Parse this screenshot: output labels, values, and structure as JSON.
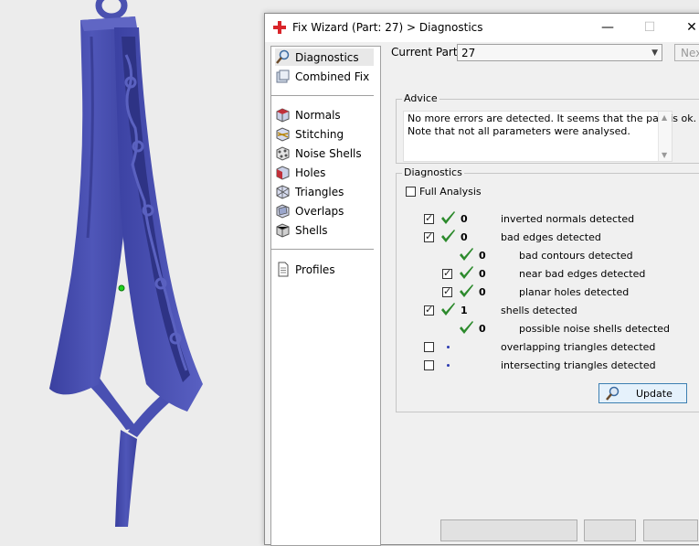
{
  "window": {
    "title": "Fix Wizard (Part: 27) > Diagnostics",
    "minimize_glyph": "—",
    "maximize_glyph": "☐",
    "close_glyph": "✕"
  },
  "sidebar": {
    "items": [
      {
        "label": "Diagnostics",
        "icon": "magnifier-icon"
      },
      {
        "label": "Combined Fix",
        "icon": "combined-fix-icon"
      },
      {
        "label": "Normals",
        "icon": "normals-cube-icon"
      },
      {
        "label": "Stitching",
        "icon": "stitching-cube-icon"
      },
      {
        "label": "Noise Shells",
        "icon": "noise-shells-icon"
      },
      {
        "label": "Holes",
        "icon": "holes-cube-icon"
      },
      {
        "label": "Triangles",
        "icon": "triangles-cube-icon"
      },
      {
        "label": "Overlaps",
        "icon": "overlaps-cube-icon"
      },
      {
        "label": "Shells",
        "icon": "shells-cube-icon"
      },
      {
        "label": "Profiles",
        "icon": "profiles-document-icon"
      }
    ]
  },
  "part": {
    "label": "Current Part:",
    "value": "27",
    "next_label": "Next"
  },
  "advice": {
    "group_label": "Advice",
    "line1": "No more errors are detected. It seems that the part is ok.",
    "line2": "Note that not all parameters were analysed."
  },
  "diagnostics": {
    "group_label": "Diagnostics",
    "full_analysis_label": "Full Analysis",
    "full_analysis_checked": false,
    "rows": [
      {
        "count": "0",
        "text": "inverted normals detected",
        "checkbox": true,
        "checked": true,
        "status": "ok",
        "indent": false
      },
      {
        "count": "0",
        "text": "bad edges detected",
        "checkbox": true,
        "checked": true,
        "status": "ok",
        "indent": false
      },
      {
        "count": "0",
        "text": "bad contours detected",
        "checkbox": false,
        "checked": false,
        "status": "ok",
        "indent": true
      },
      {
        "count": "0",
        "text": "near bad edges detected",
        "checkbox": true,
        "checked": true,
        "status": "ok",
        "indent": true
      },
      {
        "count": "0",
        "text": "planar holes detected",
        "checkbox": true,
        "checked": true,
        "status": "ok",
        "indent": true
      },
      {
        "count": "1",
        "text": "shells detected",
        "checkbox": true,
        "checked": true,
        "status": "ok",
        "indent": false
      },
      {
        "count": "0",
        "text": "possible noise shells detected",
        "checkbox": false,
        "checked": false,
        "status": "ok",
        "indent": true
      },
      {
        "count": "",
        "text": "overlapping triangles detected",
        "checkbox": true,
        "checked": false,
        "status": "pending",
        "indent": false
      },
      {
        "count": "",
        "text": "intersecting triangles detected",
        "checkbox": true,
        "checked": false,
        "status": "pending",
        "indent": false
      }
    ],
    "update_label": "Update"
  },
  "colors": {
    "model": "#4a51b0",
    "check_green": "#2c8a2c",
    "title_icon_red": "#d9252a"
  }
}
